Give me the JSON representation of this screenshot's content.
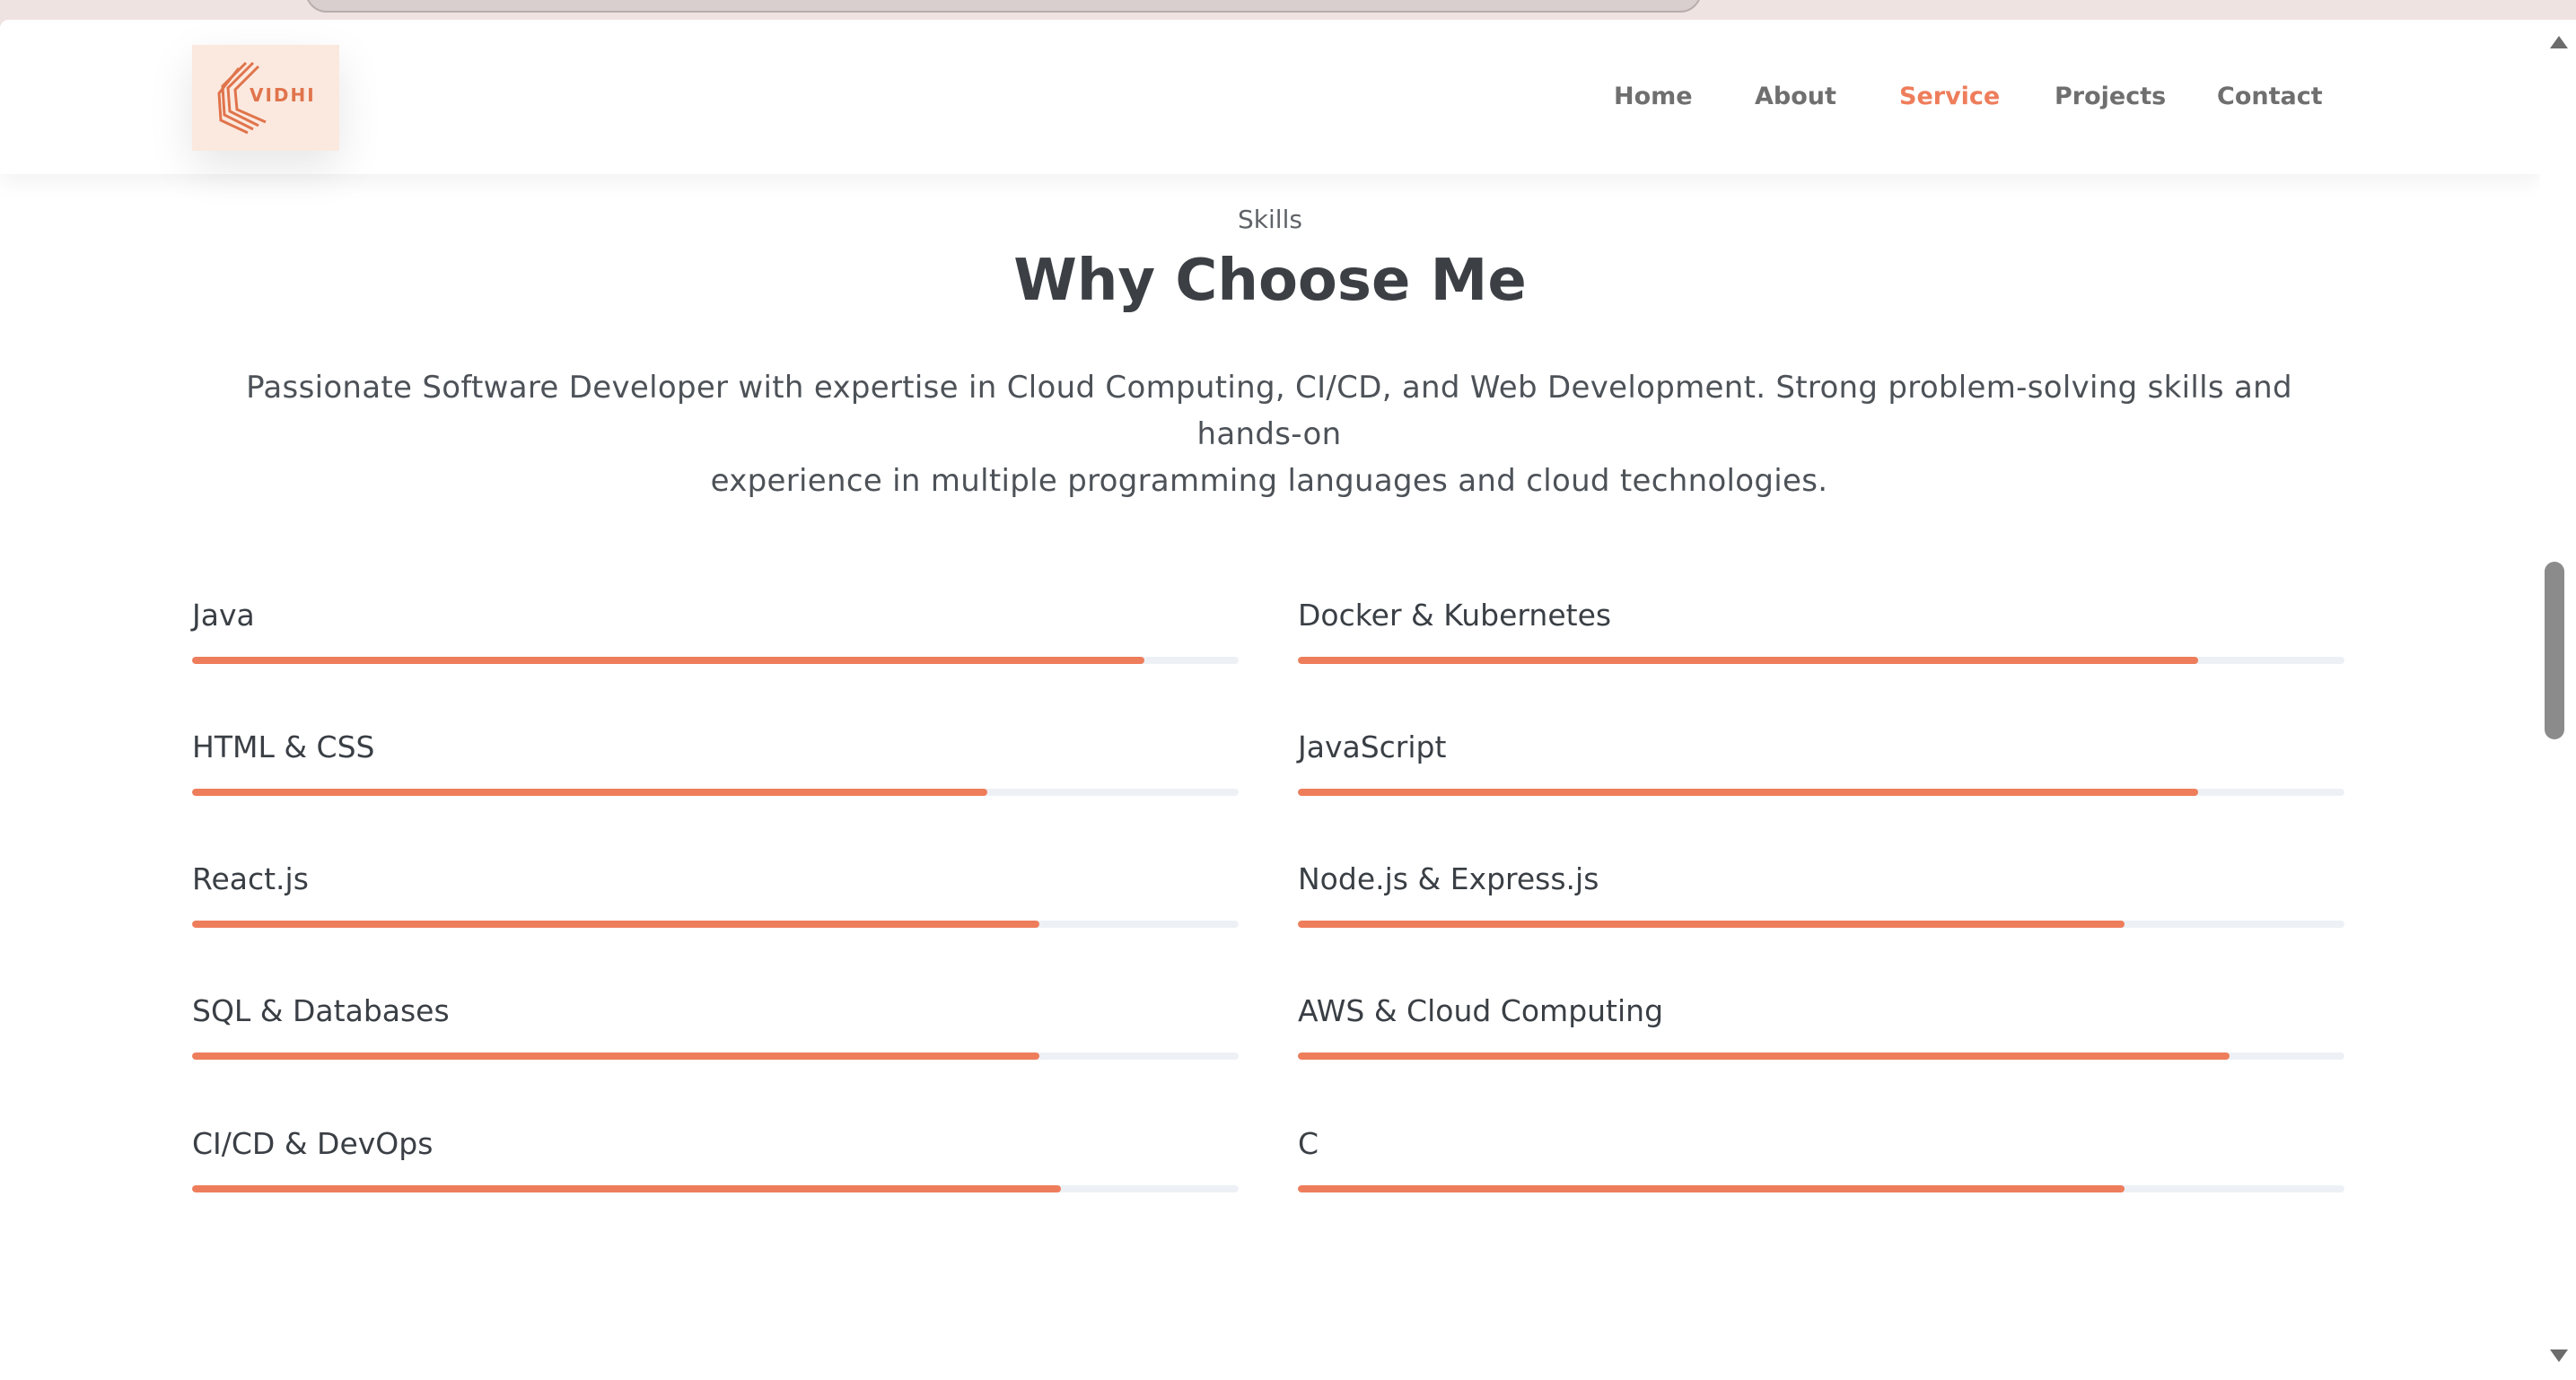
{
  "theme": {
    "accent": "#ee7d5b",
    "nav_text": "#6f6f6f",
    "heading": "#3c4045",
    "logo_text": "#e0744c",
    "bar_track": "#edf1f6"
  },
  "header": {
    "logo": {
      "text": "VIDHI",
      "icon": "stacked-chevron-logo-icon"
    },
    "nav": [
      {
        "label": "Home",
        "active": false
      },
      {
        "label": "About",
        "active": false
      },
      {
        "label": "Service",
        "active": true
      },
      {
        "label": "Projects",
        "active": false
      },
      {
        "label": "Contact",
        "active": false
      }
    ]
  },
  "section": {
    "eyebrow": "Skills",
    "title": "Why Choose Me",
    "description_line1": "Passionate Software Developer with expertise in Cloud Computing, CI/CD, and Web Development. Strong problem-solving skills and hands-on",
    "description_line2": "experience in multiple programming languages and cloud technologies."
  },
  "skills": {
    "left": [
      {
        "name": "Java",
        "percent": 91
      },
      {
        "name": "HTML & CSS",
        "percent": 76
      },
      {
        "name": "React.js",
        "percent": 81
      },
      {
        "name": "SQL & Databases",
        "percent": 81
      },
      {
        "name": "CI/CD & DevOps",
        "percent": 83
      }
    ],
    "right": [
      {
        "name": "Docker & Kubernetes",
        "percent": 86
      },
      {
        "name": "JavaScript",
        "percent": 86
      },
      {
        "name": "Node.js & Express.js",
        "percent": 79
      },
      {
        "name": "AWS & Cloud Computing",
        "percent": 89
      },
      {
        "name": "C",
        "percent": 79
      }
    ]
  },
  "scrollbar": {
    "up_icon": "scroll-up-arrow-icon",
    "down_icon": "scroll-down-arrow-icon"
  }
}
